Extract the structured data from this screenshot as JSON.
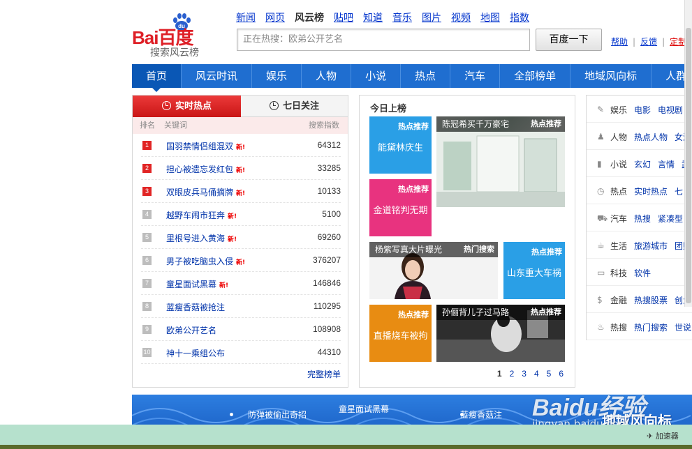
{
  "logo": {
    "brand_text": "Bai百度",
    "du_text": "du",
    "subtitle": "搜索风云榜"
  },
  "topnav": [
    "新闻",
    "网页",
    "风云榜",
    "贴吧",
    "知道",
    "音乐",
    "图片",
    "视频",
    "地图",
    "指数"
  ],
  "search": {
    "placeholder": "正在热搜：欧弟公开艺名",
    "button": "百度一下"
  },
  "toplinks": {
    "help": "帮助",
    "feedback": "反馈",
    "custom": "定制",
    "sep": "|"
  },
  "mainnav": [
    "首页",
    "风云时讯",
    "娱乐",
    "人物",
    "小说",
    "热点",
    "汽车",
    "全部榜单",
    "地域风向标",
    "人群风"
  ],
  "left": {
    "tab_realtime": "实时热点",
    "tab_7day": "七日关注",
    "header": {
      "rank": "排名",
      "keyword": "关键词",
      "index": "搜索指数"
    },
    "new_label": "新!",
    "rows": [
      {
        "rank": "1",
        "keyword": "国羽禁情侣组混双",
        "index": "64312",
        "new": true
      },
      {
        "rank": "2",
        "keyword": "担心被遗忘发红包",
        "index": "33285",
        "new": true
      },
      {
        "rank": "3",
        "keyword": "双眼皮兵马俑摘牌",
        "index": "10133",
        "new": true
      },
      {
        "rank": "4",
        "keyword": "越野车闹市狂奔",
        "index": "5100",
        "new": true
      },
      {
        "rank": "5",
        "keyword": "里根号进入黄海",
        "index": "69260",
        "new": true
      },
      {
        "rank": "6",
        "keyword": "男子被吃脑虫入侵",
        "index": "376207",
        "new": true
      },
      {
        "rank": "7",
        "keyword": "童星面试黑幕",
        "index": "146846",
        "new": true
      },
      {
        "rank": "8",
        "keyword": "蓝瘦香菇被抢注",
        "index": "110295",
        "new": false
      },
      {
        "rank": "9",
        "keyword": "欧弟公开艺名",
        "index": "108908",
        "new": false
      },
      {
        "rank": "10",
        "keyword": "神十一乘组公布",
        "index": "44310",
        "new": false
      }
    ],
    "more": "完整榜单"
  },
  "mid": {
    "title": "今日上榜",
    "tiles": [
      {
        "tag": "热点推荐",
        "text": "能黛林庆生",
        "color": "#2a9fe6"
      },
      {
        "tag": "热点推荐",
        "text": "陈冠希买千万豪宅"
      },
      {
        "tag": "热点推荐",
        "text": "金道铭判无期",
        "color": "#e8337f"
      },
      {
        "tag": "热门搜索",
        "text": "杨紫写真大片曝光"
      },
      {
        "tag": "热点推荐",
        "text": "山东重大车祸",
        "color": "#2a9fe6"
      },
      {
        "tag": "热点推荐",
        "text": "直播烧车被拘",
        "color": "#e88c12"
      },
      {
        "tag": "热点推荐",
        "text": "孙俪背儿子过马路"
      }
    ],
    "pages": [
      "1",
      "2",
      "3",
      "4",
      "5",
      "6"
    ]
  },
  "right": {
    "rows": [
      {
        "icon": "pen-icon",
        "cat": "娱乐",
        "l1": "电影",
        "l2": "电视剧"
      },
      {
        "icon": "person-icon",
        "cat": "人物",
        "l1": "热点人物",
        "l2": "女演"
      },
      {
        "icon": "book-icon",
        "cat": "小说",
        "l1": "玄幻",
        "l2": "言情",
        "l3": "武"
      },
      {
        "icon": "clock-icon",
        "cat": "热点",
        "l1": "实时热点",
        "l2": "七日"
      },
      {
        "icon": "car-icon",
        "cat": "汽车",
        "l1": "热搜",
        "l2": "紧凑型"
      },
      {
        "icon": "cup-icon",
        "cat": "生活",
        "l1": "旅游城市",
        "l2": "团购"
      },
      {
        "icon": "monitor-icon",
        "cat": "科技",
        "l1": "软件"
      },
      {
        "icon": "dollar-icon",
        "cat": "金融",
        "l1": "热搜股票",
        "l2": "创业"
      },
      {
        "icon": "flame-icon",
        "cat": "热搜",
        "l1": "热门搜索",
        "l2": "世说"
      }
    ]
  },
  "banner": {
    "items": [
      "防弹被偷出奇招",
      "童星面试黑幕",
      "蓝瘦香菇注"
    ],
    "region_title": "地域风向标"
  },
  "watermark": {
    "logo": "Baidu经验",
    "url": "jingyan.baidu.com"
  },
  "statusbar": {
    "accelerator": "加速器"
  },
  "colors": {
    "brand_red": "#de1f26",
    "nav_blue": "#1f6ed0",
    "link_blue": "#0033cc"
  }
}
